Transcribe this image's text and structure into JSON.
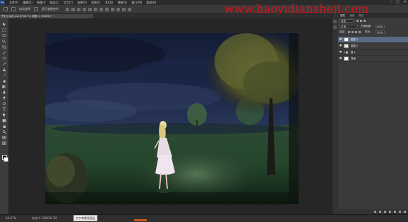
{
  "app": {
    "logo_text": "Ps"
  },
  "menus": [
    "文件(F)",
    "编辑(E)",
    "图像(I)",
    "图层(L)",
    "文字(Y)",
    "选择(S)",
    "滤镜(T)",
    "3D(D)",
    "视图(V)",
    "窗口(W)",
    "帮助(H)"
  ],
  "window_controls": [
    "–",
    "□",
    "✕"
  ],
  "options": {
    "auto_select_label": "自动选择",
    "transform_label": "显示变换控件"
  },
  "watermark": "www.haoyidiansheji.com",
  "document_tab": {
    "title": "梦幻小女孩.psd @ 66.7% (图层 1, RGB/8) *"
  },
  "status": {
    "zoom": "66.67%",
    "doc_info": "文档:4.12M/26.7M",
    "tooltip": "文字和蒙版图层"
  },
  "layers_panel": {
    "tabs": [
      "图层",
      "通道",
      "路径"
    ],
    "kind_label": "类型",
    "blend_mode": "正常",
    "opacity_label": "不透明度:",
    "opacity": "100%",
    "lock_label": "锁定:",
    "fill_label": "填充:",
    "fill": "100%",
    "layers": [
      {
        "name": "图层 1",
        "thumb": "#ffffff",
        "selected": true
      },
      {
        "name": "图层 0",
        "thumb": "#e8e8e8",
        "selected": false
      },
      {
        "name": "组 1",
        "thumb": "",
        "selected": false
      },
      {
        "name": "背景",
        "thumb": "#ffffff",
        "selected": false
      }
    ]
  },
  "colors": {
    "accent": "#c25a1e",
    "watermark": "#d4151a",
    "selected_layer": "#5a6a85"
  }
}
